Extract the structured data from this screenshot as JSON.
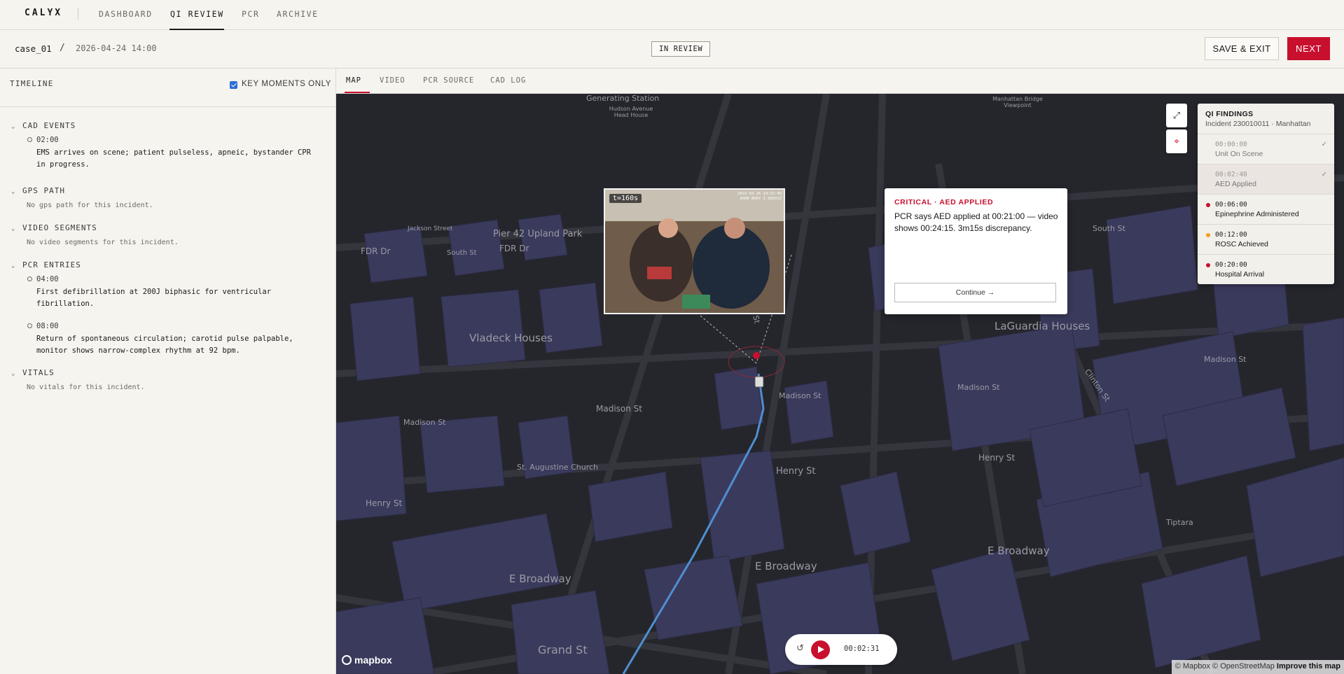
{
  "nav": {
    "brand": "CALYX",
    "links": [
      "DASHBOARD",
      "QI REVIEW",
      "PCR",
      "ARCHIVE"
    ],
    "active": "QI REVIEW"
  },
  "case": {
    "id": "case_01",
    "separator": "/",
    "date": "2026-04-24 14:00",
    "status": "IN REVIEW",
    "save_label": "SAVE & EXIT",
    "next_label": "NEXT"
  },
  "sidebar": {
    "title": "TIMELINE",
    "key_moments_label": "KEY MOMENTS ONLY",
    "key_moments_checked": true,
    "sections": {
      "cad": {
        "title": "CAD EVENTS",
        "events": [
          {
            "time": "02:00",
            "text": "EMS arrives on scene; patient pulseless, apneic, bystander CPR in progress."
          }
        ]
      },
      "gps": {
        "title": "GPS PATH",
        "empty": "No gps path for this incident."
      },
      "video": {
        "title": "VIDEO SEGMENTS",
        "empty": "No video segments for this incident."
      },
      "pcr": {
        "title": "PCR ENTRIES",
        "events": [
          {
            "time": "04:00",
            "text": "First defibrillation at 200J biphasic for ventricular fibrillation."
          },
          {
            "time": "08:00",
            "text": "Return of spontaneous circulation; carotid pulse palpable, monitor shows narrow-complex rhythm at 92 bpm."
          }
        ]
      },
      "vitals": {
        "title": "VITALS",
        "empty": "No vitals for this incident."
      }
    }
  },
  "tabs": [
    "MAP",
    "VIDEO",
    "PCR SOURCE",
    "CAD LOG"
  ],
  "active_tab": "MAP",
  "video_overlay": {
    "time_label": "t=160s",
    "stamp_line1": "2022-03-16 14:32:40",
    "stamp_line2": "AXON BODY 3 X6031Z"
  },
  "alert": {
    "title": "CRITICAL · AED APPLIED",
    "body": "PCR says AED applied at 00:21:00 — video shows 00:24:15. 3m15s discrepancy.",
    "button": "Continue →"
  },
  "findings": {
    "title": "QI FINDINGS",
    "subtitle": "Incident 230010011 · Manhattan",
    "items": [
      {
        "time": "00:00:00",
        "label": "Unit On Scene",
        "state": "done"
      },
      {
        "time": "00:02:40",
        "label": "AED Applied",
        "state": "done-highlight"
      },
      {
        "time": "00:06:00",
        "label": "Epinephrine Administered",
        "state": "critical"
      },
      {
        "time": "00:12:00",
        "label": "ROSC Achieved",
        "state": "warning"
      },
      {
        "time": "00:20:00",
        "label": "Hospital Arrival",
        "state": "critical"
      }
    ]
  },
  "player": {
    "time": "00:02:31"
  },
  "map": {
    "logo": "mapbox",
    "attribution": "© Mapbox © OpenStreetMap",
    "improve": "Improve this map",
    "street_labels": [
      "FDR Dr",
      "FDR Dr",
      "Pier 42 Upland Park",
      "Jackson Street",
      "South St",
      "Vladeck Houses",
      "Madison St",
      "Madison St",
      "Madison St",
      "Madison St",
      "Henry St",
      "Henry St",
      "Henry St",
      "E Broadway",
      "E Broadway",
      "E Broadway",
      "Grand St",
      "Montgomery St",
      "Clinton St",
      "LaGuardia Houses",
      "South St",
      "Madison St",
      "Tiptara",
      "Hudson Avenue Head House",
      "Manhattan Bridge Viewpoint",
      "St. Augustine Church",
      "Generating Station"
    ]
  },
  "colors": {
    "accent": "#c8102e",
    "warning": "#f0a020",
    "map_bg": "#25262c",
    "route": "#4f8fd0"
  }
}
